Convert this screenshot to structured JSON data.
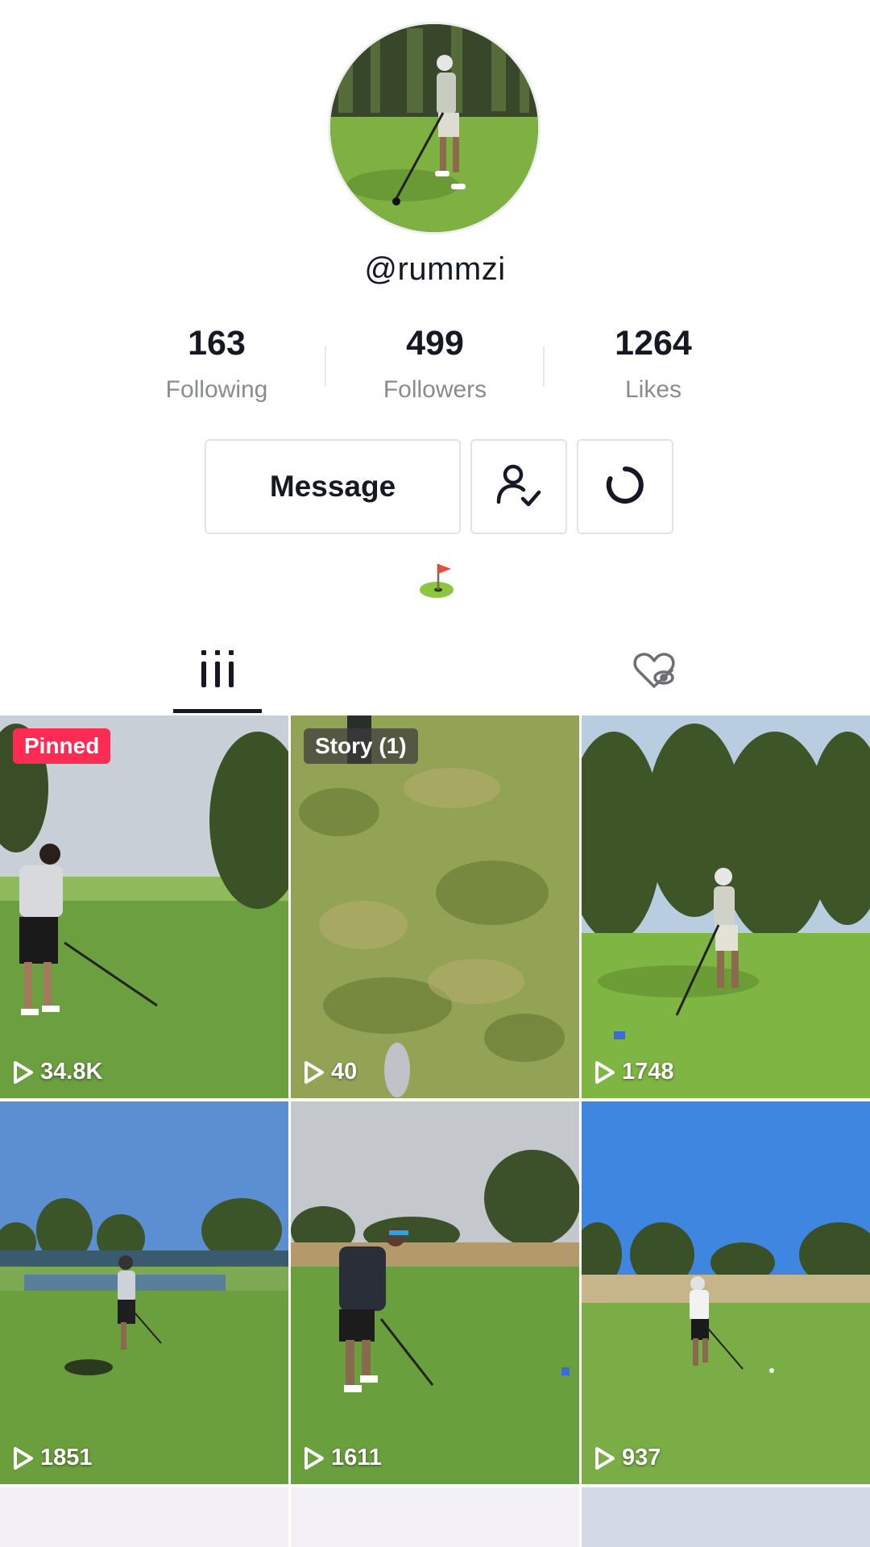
{
  "profile": {
    "handle": "@rummzi",
    "bio_emoji": "flag-in-hole-icon"
  },
  "stats": [
    {
      "value": "163",
      "label": "Following"
    },
    {
      "value": "499",
      "label": "Followers"
    },
    {
      "value": "1264",
      "label": "Likes"
    }
  ],
  "actions": {
    "message_label": "Message",
    "friends_icon": "user-check-icon",
    "refresh_icon": "refresh-icon"
  },
  "tabs": [
    {
      "icon": "grid-icon",
      "active": true
    },
    {
      "icon": "liked-hidden-icon",
      "active": false
    }
  ],
  "videos": [
    {
      "badge": "Pinned",
      "views": "34.8K"
    },
    {
      "badge": "Story (1)",
      "views": "40"
    },
    {
      "badge": "",
      "views": "1748"
    },
    {
      "badge": "",
      "views": "1851"
    },
    {
      "badge": "",
      "views": "1611"
    },
    {
      "badge": "",
      "views": "937"
    }
  ],
  "colors": {
    "accent_pinned": "#fe2c55",
    "text_primary": "#161823",
    "text_secondary": "#8a8b91",
    "grass": "#7da955"
  }
}
